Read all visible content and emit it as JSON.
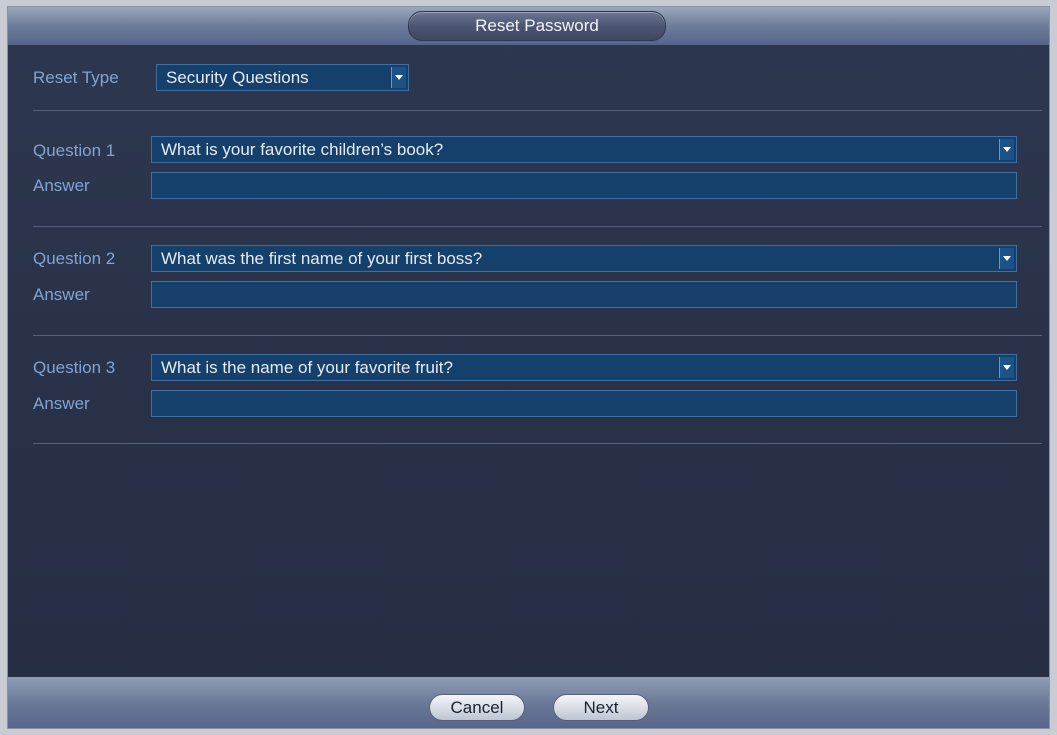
{
  "dialog": {
    "title": "Reset Password"
  },
  "reset_type": {
    "label": "Reset Type",
    "value": "Security Questions"
  },
  "questions": [
    {
      "label": "Question 1",
      "value": "What is your favorite children’s book?",
      "answer_label": "Answer",
      "answer_value": ""
    },
    {
      "label": "Question 2",
      "value": "What was the first name of your first boss?",
      "answer_label": "Answer",
      "answer_value": ""
    },
    {
      "label": "Question 3",
      "value": "What is the name of your favorite fruit?",
      "answer_label": "Answer",
      "answer_value": ""
    }
  ],
  "footer": {
    "cancel_label": "Cancel",
    "next_label": "Next"
  },
  "icons": {
    "dropdown": "chevron-down-icon"
  },
  "colors": {
    "background": "#293148",
    "label": "#7fa5d4",
    "field": "#15406b",
    "field_border": "#3f6fa0"
  }
}
